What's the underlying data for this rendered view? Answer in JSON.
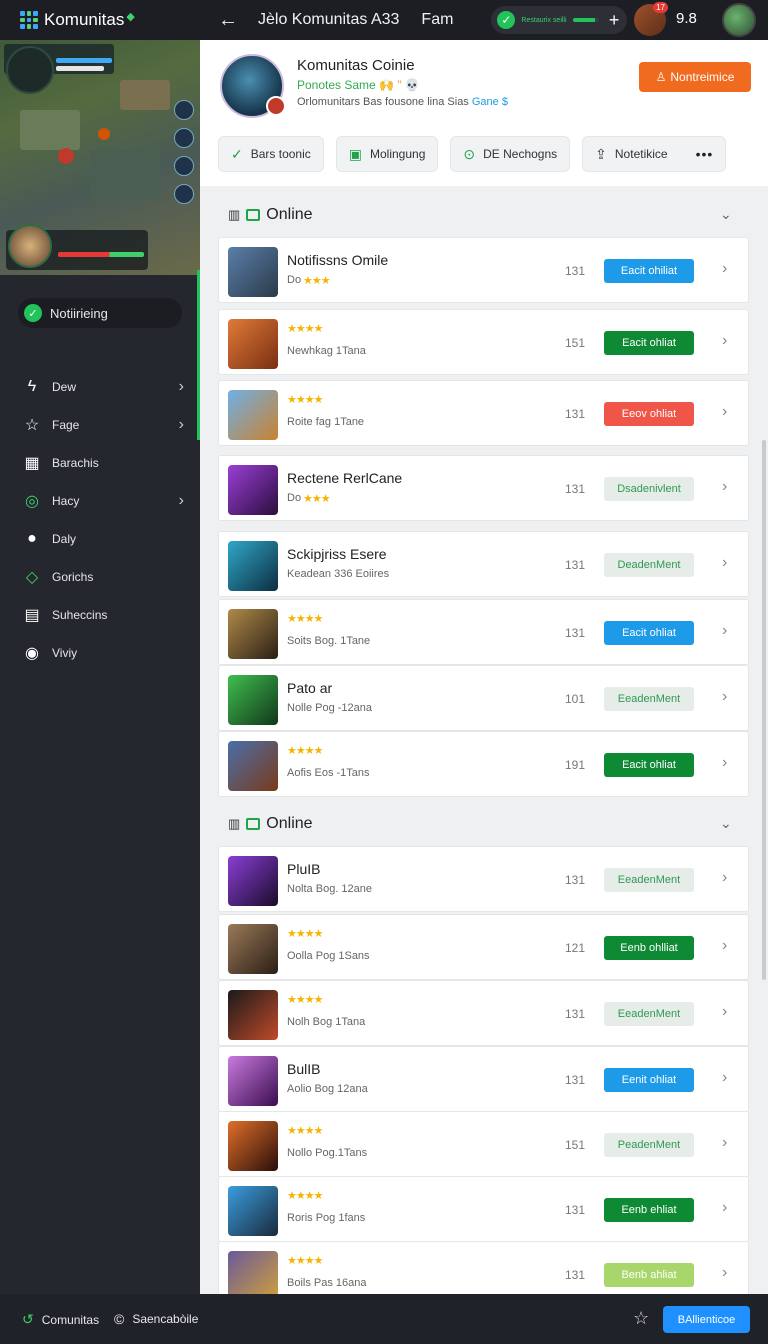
{
  "topbar": {
    "brand": "Komunitas",
    "back_icon": "arrow-left-icon",
    "title": "Jèlo Komunitas A33",
    "subtitle": "Fam",
    "pill_text": "Restaurix seilli",
    "pill_progress": 0.85,
    "notif_badge": "17",
    "count": "9.8"
  },
  "sidebar": {
    "status_label": "Notiirieing",
    "items": [
      {
        "label": "Dew",
        "icon": "lightning-icon",
        "chevron": true
      },
      {
        "label": "Fage",
        "icon": "star-icon",
        "chevron": true
      },
      {
        "label": "Barachis",
        "icon": "grid-icon",
        "chevron": false
      },
      {
        "label": "Hacy",
        "icon": "target-icon",
        "chevron": true
      },
      {
        "label": "Daly",
        "icon": "coin-icon",
        "chevron": false
      },
      {
        "label": "Gorichs",
        "icon": "gem-icon",
        "chevron": false
      },
      {
        "label": "Suheccins",
        "icon": "window-icon",
        "chevron": false
      },
      {
        "label": "Viviy",
        "icon": "globe-icon",
        "chevron": false
      }
    ]
  },
  "header": {
    "title": "Komunitas Coinie",
    "line2": "Ponotes Same",
    "line2_extra": "🙌 \" 💀",
    "line3": "Orlomunitars Bas fousone lina Sias",
    "line3_link": "Gane $",
    "follow_button": "Nontreimice",
    "tabs": [
      {
        "label": "Bars toonic",
        "icon": "check-icon"
      },
      {
        "label": "Molingung",
        "icon": "document-icon"
      },
      {
        "label": "DE Nechogns",
        "icon": "clock-icon"
      },
      {
        "label": "Notetikice",
        "icon": "share-icon",
        "more": "•••"
      }
    ]
  },
  "sections": [
    {
      "title": "Online",
      "rows": [
        {
          "name": "Notifissns Omile",
          "sub": "Do",
          "stars": "★★★",
          "num": "131",
          "action": "Eacit ohiliat",
          "style": "blue"
        },
        {
          "name": "",
          "sub": "Newhkag 1Tana",
          "stars": "★★★★",
          "num": "151",
          "action": "Eacit ohliat",
          "style": "green"
        },
        {
          "name": "",
          "sub": "Roite fag 1Tane",
          "stars": "★★★★",
          "num": "131",
          "action": "Eeov ohliat",
          "style": "red"
        },
        {
          "name": "Rectene RerlCane",
          "sub": "Do",
          "stars": "★★★",
          "num": "131",
          "action": "Dsadenivlent",
          "style": "light"
        },
        {
          "name": "Sckipjriss Esere",
          "sub": "Keadean 336 Eoiires",
          "stars": "",
          "num": "131",
          "action": "DeadenMent",
          "style": "light"
        },
        {
          "name": "",
          "sub": "Soits Bog. 1Tane",
          "stars": "★★★★",
          "num": "131",
          "action": "Eacit ohliat",
          "style": "blue"
        },
        {
          "name": "Pato ar",
          "sub": "Nolle Pog -12ana",
          "stars": "",
          "num": "101",
          "action": "EeadenMent",
          "style": "light"
        },
        {
          "name": "",
          "sub": "Aofis Eos -1Tans",
          "stars": "★★★★",
          "num": "191",
          "action": "Eacit ohliat",
          "style": "green"
        }
      ]
    },
    {
      "title": "Online",
      "rows": [
        {
          "name": "PluIB",
          "sub": "Nolta Bog. 12ane",
          "stars": "",
          "num": "131",
          "action": "EeadenMent",
          "style": "light"
        },
        {
          "name": "",
          "sub": "Oolla Pog 1Sans",
          "stars": "★★★★",
          "num": "121",
          "action": "Eenb ohlliat",
          "style": "green"
        },
        {
          "name": "",
          "sub": "Nolh Bog 1Tana",
          "stars": "★★★★",
          "num": "131",
          "action": "EeadenMent",
          "style": "light"
        },
        {
          "name": "BulIB",
          "sub": "Aolio Bog 12ana",
          "stars": "",
          "num": "131",
          "action": "Eenit ohliat",
          "style": "blue"
        },
        {
          "name": "",
          "sub": "Nollo Pog.1Tans",
          "stars": "★★★★",
          "num": "151",
          "action": "PeadenMent",
          "style": "light"
        },
        {
          "name": "",
          "sub": "Roris Pog 1fans",
          "stars": "★★★★",
          "num": "131",
          "action": "Eenb ehliat",
          "style": "green"
        },
        {
          "name": "",
          "sub": "Boils Pas 16ana",
          "stars": "★★★★",
          "num": "131",
          "action": "Benb ahliat",
          "style": "lime"
        }
      ]
    }
  ],
  "bottombar": {
    "item1": "Comunitas",
    "item2": "Saencabòile",
    "button": "BAllienticoe"
  },
  "colors": {
    "accent_green": "#21c35a",
    "orange": "#f06a1f",
    "blue": "#1e90ff"
  }
}
